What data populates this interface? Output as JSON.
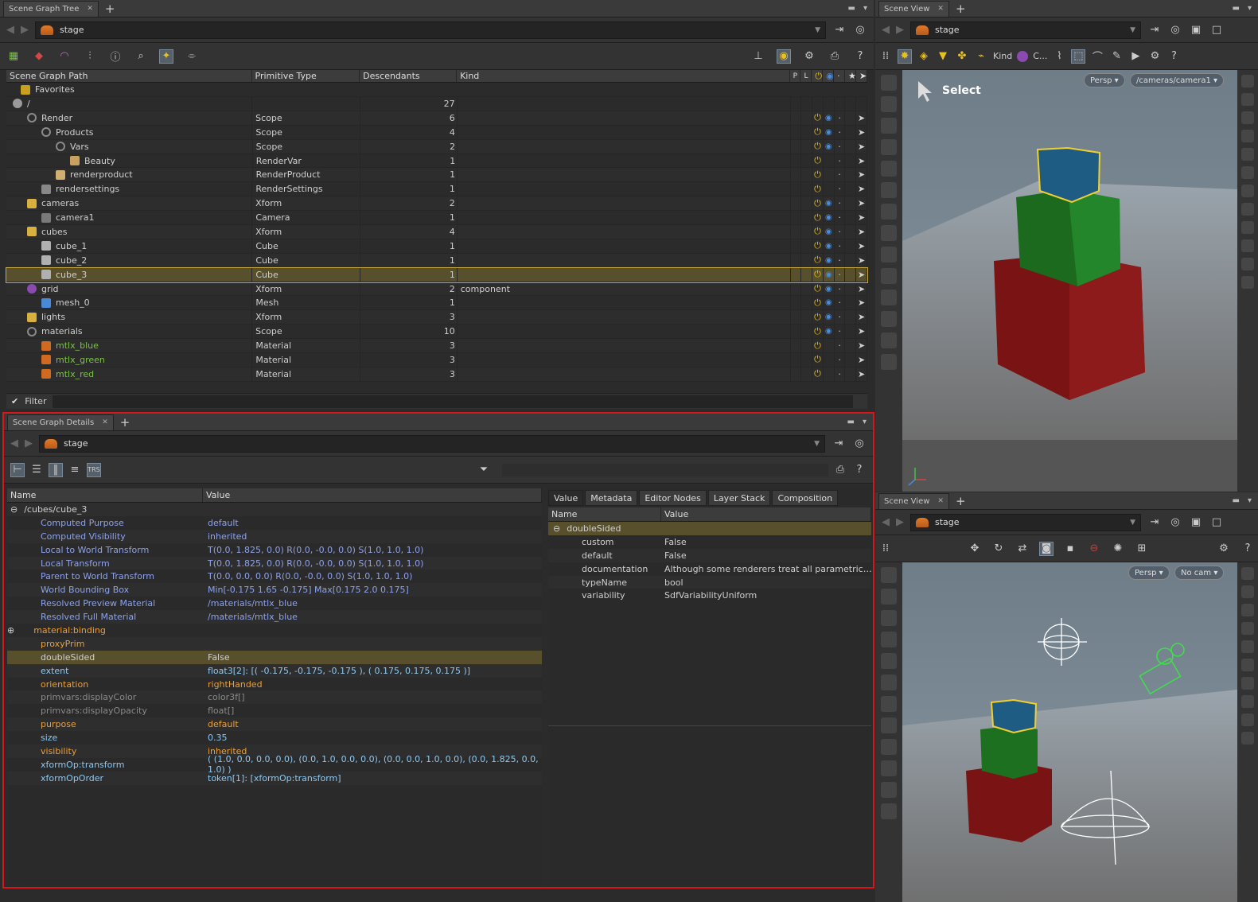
{
  "tree_panel": {
    "tab_label": "Scene Graph Tree",
    "path_value": "stage",
    "columns": [
      "Scene Graph Path",
      "Primitive Type",
      "Descendants",
      "Kind"
    ],
    "flag_columns": [
      "P",
      "L"
    ],
    "favorites_label": "Favorites",
    "filter_label": "Filter",
    "rows": [
      {
        "name": "/",
        "type": "",
        "desc": "27",
        "kind": "",
        "depth": 0,
        "icon": "root-icon"
      },
      {
        "name": "Render",
        "type": "Scope",
        "desc": "6",
        "kind": "",
        "depth": 1,
        "icon": "scope-icon"
      },
      {
        "name": "Products",
        "type": "Scope",
        "desc": "4",
        "kind": "",
        "depth": 2,
        "icon": "scope-icon"
      },
      {
        "name": "Vars",
        "type": "Scope",
        "desc": "2",
        "kind": "",
        "depth": 3,
        "icon": "scope-icon"
      },
      {
        "name": "Beauty",
        "type": "RenderVar",
        "desc": "1",
        "kind": "",
        "depth": 4,
        "icon": "rendervar-icon"
      },
      {
        "name": "renderproduct",
        "type": "RenderProduct",
        "desc": "1",
        "kind": "",
        "depth": 3,
        "icon": "renderproduct-icon"
      },
      {
        "name": "rendersettings",
        "type": "RenderSettings",
        "desc": "1",
        "kind": "",
        "depth": 2,
        "icon": "rendersettings-icon"
      },
      {
        "name": "cameras",
        "type": "Xform",
        "desc": "2",
        "kind": "",
        "depth": 1,
        "icon": "xform-icon"
      },
      {
        "name": "camera1",
        "type": "Camera",
        "desc": "1",
        "kind": "",
        "depth": 2,
        "icon": "camera-icon"
      },
      {
        "name": "cubes",
        "type": "Xform",
        "desc": "4",
        "kind": "",
        "depth": 1,
        "icon": "xform-icon"
      },
      {
        "name": "cube_1",
        "type": "Cube",
        "desc": "1",
        "kind": "",
        "depth": 2,
        "icon": "cube-icon"
      },
      {
        "name": "cube_2",
        "type": "Cube",
        "desc": "1",
        "kind": "",
        "depth": 2,
        "icon": "cube-icon"
      },
      {
        "name": "cube_3",
        "type": "Cube",
        "desc": "1",
        "kind": "",
        "depth": 2,
        "icon": "cube-icon",
        "selected": true
      },
      {
        "name": "grid",
        "type": "Xform",
        "desc": "2",
        "kind": "component",
        "depth": 1,
        "icon": "component-icon"
      },
      {
        "name": "mesh_0",
        "type": "Mesh",
        "desc": "1",
        "kind": "",
        "depth": 2,
        "icon": "mesh-icon"
      },
      {
        "name": "lights",
        "type": "Xform",
        "desc": "3",
        "kind": "",
        "depth": 1,
        "icon": "xform-icon"
      },
      {
        "name": "materials",
        "type": "Scope",
        "desc": "10",
        "kind": "",
        "depth": 1,
        "icon": "scope-icon"
      },
      {
        "name": "mtlx_blue",
        "type": "Material",
        "desc": "3",
        "kind": "",
        "depth": 2,
        "icon": "material-icon",
        "green": true
      },
      {
        "name": "mtlx_green",
        "type": "Material",
        "desc": "3",
        "kind": "",
        "depth": 2,
        "icon": "material-icon",
        "green": true
      },
      {
        "name": "mtlx_red",
        "type": "Material",
        "desc": "3",
        "kind": "",
        "depth": 2,
        "icon": "material-icon",
        "green": true
      }
    ]
  },
  "details_panel": {
    "tab_label": "Scene Graph Details",
    "path_value": "stage",
    "columns": [
      "Name",
      "Value"
    ],
    "prim_path": "/cubes/cube_3",
    "rows": [
      {
        "name": "Computed Purpose",
        "value": "default",
        "style": "blue"
      },
      {
        "name": "Computed Visibility",
        "value": "inherited",
        "style": "blue"
      },
      {
        "name": "Local to World Transform",
        "value": "T(0.0, 1.825, 0.0) R(0.0, -0.0, 0.0) S(1.0, 1.0, 1.0)",
        "style": "blue"
      },
      {
        "name": "Local Transform",
        "value": "T(0.0, 1.825, 0.0) R(0.0, -0.0, 0.0) S(1.0, 1.0, 1.0)",
        "style": "blue"
      },
      {
        "name": "Parent to World Transform",
        "value": "T(0.0, 0.0, 0.0) R(0.0, -0.0, 0.0) S(1.0, 1.0, 1.0)",
        "style": "blue"
      },
      {
        "name": "World Bounding Box",
        "value": "Min[-0.175 1.65 -0.175] Max[0.175 2.0 0.175]",
        "style": "blue"
      },
      {
        "name": "Resolved Preview Material",
        "value": "/materials/mtlx_blue",
        "style": "blue"
      },
      {
        "name": "Resolved Full Material",
        "value": "/materials/mtlx_blue",
        "style": "blue"
      },
      {
        "name": "material:binding",
        "value": "",
        "style": "orange"
      },
      {
        "name": "proxyPrim",
        "value": "",
        "style": "orange"
      },
      {
        "name": "doubleSided",
        "value": "False",
        "style": "selected"
      },
      {
        "name": "extent",
        "value": "float3[2]: [( -0.175, -0.175, -0.175 ), ( 0.175, 0.175, 0.175 )]",
        "style": "lblue"
      },
      {
        "name": "orientation",
        "value": "rightHanded",
        "style": "orange"
      },
      {
        "name": "primvars:displayColor",
        "value": "color3f[]",
        "style": "gray"
      },
      {
        "name": "primvars:displayOpacity",
        "value": "float[]",
        "style": "gray"
      },
      {
        "name": "purpose",
        "value": "default",
        "style": "orange"
      },
      {
        "name": "size",
        "value": "0.35",
        "style": "lblue"
      },
      {
        "name": "visibility",
        "value": "inherited",
        "style": "orange"
      },
      {
        "name": "xformOp:transform",
        "value": "( (1.0, 0.0, 0.0, 0.0), (0.0, 1.0, 0.0, 0.0), (0.0, 0.0, 1.0, 0.0), (0.0, 1.825, 0.0, 1.0) )",
        "style": "lblue"
      },
      {
        "name": "xformOpOrder",
        "value": "token[1]: [xformOp:transform]",
        "style": "lblue"
      }
    ],
    "right_tabs": [
      "Value",
      "Metadata",
      "Editor Nodes",
      "Layer Stack",
      "Composition"
    ],
    "right_columns": [
      "Name",
      "Value"
    ],
    "attr_name": "doubleSided",
    "metadata": [
      {
        "name": "custom",
        "value": "False"
      },
      {
        "name": "default",
        "value": "False"
      },
      {
        "name": "documentation",
        "value": "Although some renderers treat all parametric…"
      },
      {
        "name": "typeName",
        "value": "bool"
      },
      {
        "name": "variability",
        "value": "SdfVariabilityUniform"
      }
    ]
  },
  "viewport_top": {
    "tab_label": "Scene View",
    "path_value": "stage",
    "kind_label": "Kind",
    "kind_value": "C...",
    "select_label": "Select",
    "persp_label": "Persp",
    "camera_label": "/cameras/camera1"
  },
  "viewport_bottom": {
    "tab_label": "Scene View",
    "path_value": "stage",
    "persp_label": "Persp",
    "camera_label": "No cam"
  },
  "colors": {
    "selection_outline": "#d8161c",
    "selected_row": "#58502c",
    "viewport_sky": "#7d8c98",
    "cube_red": "#8a1a1a",
    "cube_green": "#1f7a22",
    "cube_blue": "#1d5d8a"
  }
}
